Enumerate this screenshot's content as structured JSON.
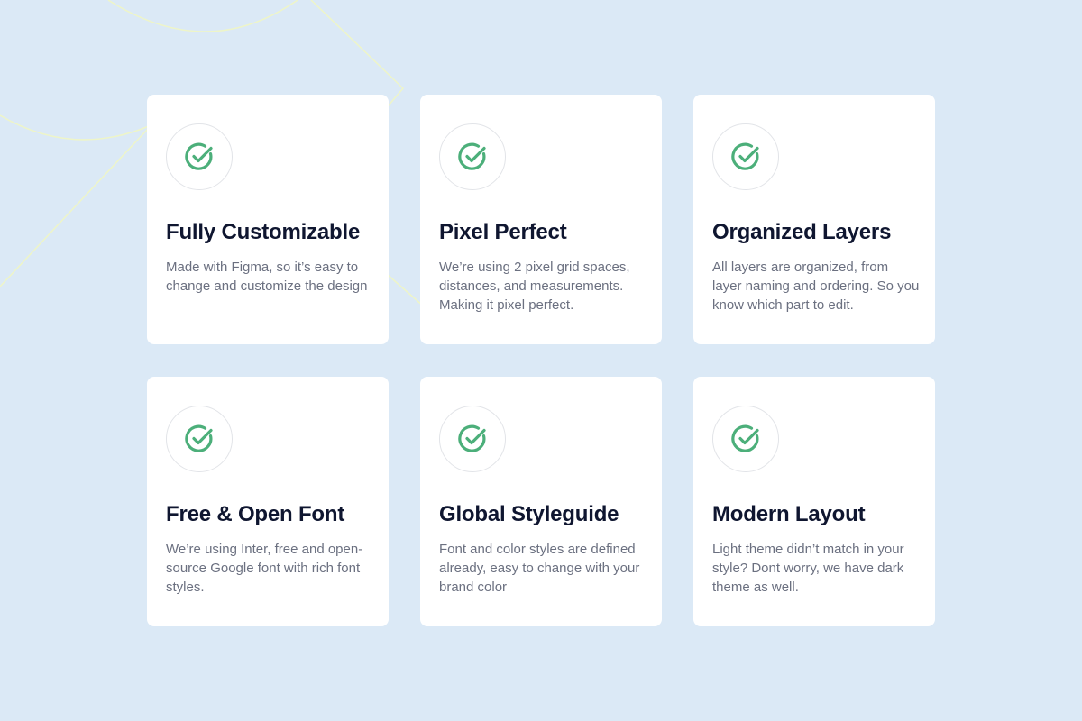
{
  "colors": {
    "background": "#dbe9f6",
    "card": "#ffffff",
    "accent_green": "#4caf7a",
    "title": "#0f1630",
    "body_text": "#6b7080"
  },
  "features": [
    {
      "icon": "check-circle-icon",
      "title": "Fully Customizable",
      "description": "Made with Figma, so it’s easy to change and customize the design"
    },
    {
      "icon": "check-circle-icon",
      "title": "Pixel Perfect",
      "description": "We’re using 2 pixel grid spaces, distances, and measurements. Making it pixel perfect."
    },
    {
      "icon": "check-circle-icon",
      "title": "Organized Layers",
      "description": "All layers are organized, from layer naming and ordering. So you know which part to edit."
    },
    {
      "icon": "check-circle-icon",
      "title": "Free & Open Font",
      "description": "We’re using Inter, free and open-source Google font with rich font styles."
    },
    {
      "icon": "check-circle-icon",
      "title": "Global Styleguide",
      "description": "Font and color styles are defined already, easy to change with your brand color"
    },
    {
      "icon": "check-circle-icon",
      "title": "Modern Layout",
      "description": "Light theme didn’t match in your style? Dont worry, we have dark theme as well."
    }
  ]
}
